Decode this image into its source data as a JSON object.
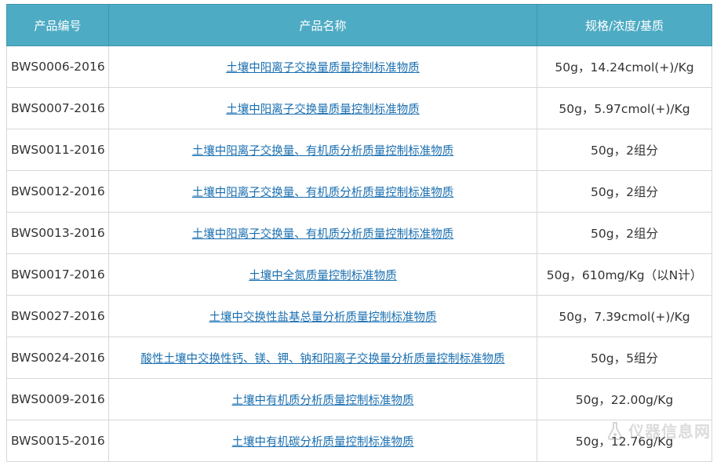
{
  "table": {
    "headers": [
      "产品编号",
      "产品名称",
      "规格/浓度/基质"
    ],
    "rows": [
      {
        "code": "BWS0006-2016",
        "name": "土壤中阳离子交换量质量控制标准物质",
        "spec": "50g，14.24cmol(+)/Kg"
      },
      {
        "code": "BWS0007-2016",
        "name": "土壤中阳离子交换量质量控制标准物质",
        "spec": "50g，5.97cmol(+)/Kg"
      },
      {
        "code": "BWS0011-2016",
        "name": "土壤中阳离子交换量、有机质分析质量控制标准物质",
        "spec": "50g，2组分"
      },
      {
        "code": "BWS0012-2016",
        "name": "土壤中阳离子交换量、有机质分析质量控制标准物质",
        "spec": "50g，2组分"
      },
      {
        "code": "BWS0013-2016",
        "name": "土壤中阳离子交换量、有机质分析质量控制标准物质",
        "spec": "50g，2组分"
      },
      {
        "code": "BWS0017-2016",
        "name": "土壤中全氮质量控制标准物质",
        "spec": "50g，610mg/Kg（以N计）"
      },
      {
        "code": "BWS0027-2016",
        "name": "土壤中交换性盐基总量分析质量控制标准物质",
        "spec": "50g，7.39cmol(+)/Kg"
      },
      {
        "code": "BWS0024-2016",
        "name": "酸性土壤中交换性钙、镁、钾、钠和阳离子交换量分析质量控制标准物质",
        "spec": "50g，5组分"
      },
      {
        "code": "BWS0009-2016",
        "name": "土壤中有机质分析质量控制标准物质",
        "spec": "50g，22.00g/Kg"
      },
      {
        "code": "BWS0015-2016",
        "name": "土壤中有机碳分析质量控制标准物质",
        "spec": "50g，12.76g/Kg"
      }
    ]
  },
  "watermark": {
    "text": "仪器信息网",
    "icon": "flask-logo-icon"
  },
  "colors": {
    "header_bg": "#4eabc4",
    "header_text": "#ffffff",
    "link": "#1a6fb0",
    "border": "#d7d7d7"
  }
}
